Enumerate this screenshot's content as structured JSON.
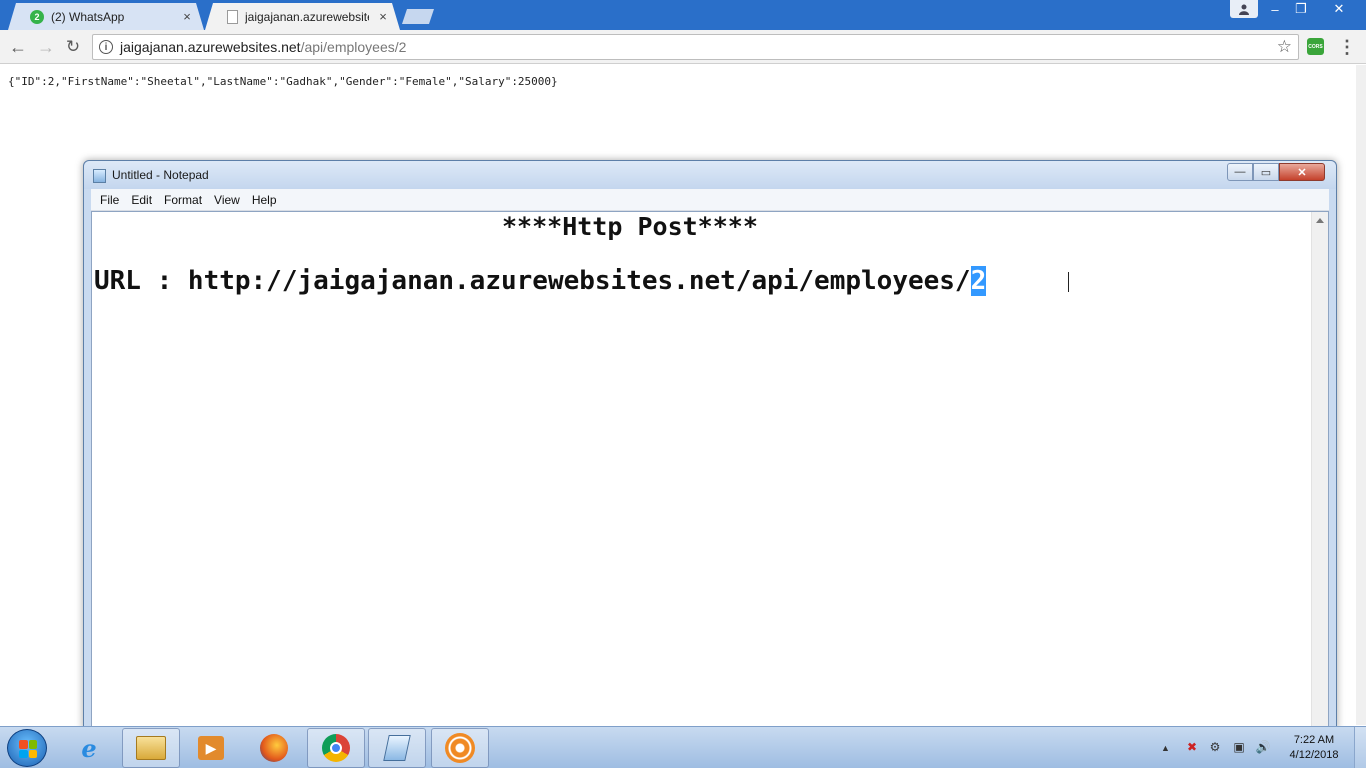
{
  "browser": {
    "tabs": [
      {
        "title": "(2) WhatsApp",
        "badge": "2",
        "close": "×"
      },
      {
        "title": "jaigajanan.azurewebsites",
        "close": "×"
      }
    ],
    "window_controls": {
      "minimize": "–",
      "maximize": "❐",
      "close": "✕"
    },
    "nav": {
      "back": "←",
      "forward": "→",
      "reload": "↻"
    },
    "address": {
      "host": "jaigajanan.azurewebsites.net",
      "path": "/api/employees/2"
    },
    "extension_label": "CORS",
    "page_content": "{\"ID\":2,\"FirstName\":\"Sheetal\",\"LastName\":\"Gadhak\",\"Gender\":\"Female\",\"Salary\":25000}"
  },
  "notepad": {
    "title": "Untitled - Notepad",
    "menu": [
      "File",
      "Edit",
      "Format",
      "View",
      "Help"
    ],
    "controls": {
      "minimize": "—",
      "maximize": "▭",
      "close": "✕"
    },
    "text": {
      "heading": "****Http Post****",
      "url_prefix": "URL : http://jaigajanan.azurewebsites.net/api/employees/",
      "url_selected": "2"
    }
  },
  "taskbar": {
    "tray": {
      "arrow": "▲",
      "icons": [
        "✖",
        "⚙",
        "▣",
        "🔊"
      ]
    },
    "clock": {
      "time": "7:22 AM",
      "date": "4/12/2018"
    }
  },
  "colors": {
    "chrome_titlebar": "#2a6fc9",
    "selection": "#3399ff",
    "whatsapp_green": "#35b34a",
    "notepad_close": "#c4412b"
  }
}
